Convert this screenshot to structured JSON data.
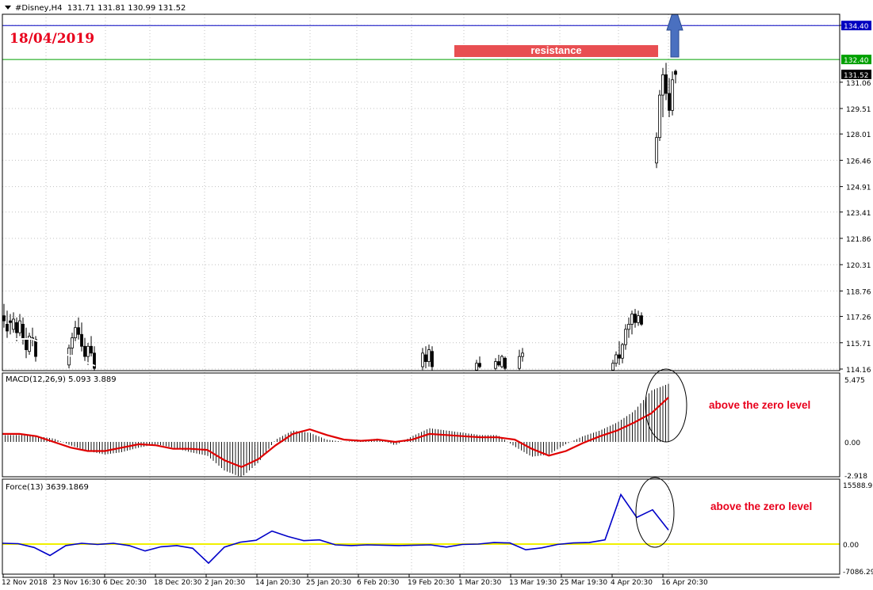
{
  "header": {
    "symbol_label": "#Disney,H4",
    "ohlc": "131.71 131.81 130.99 131.52",
    "date_annotation": "18/04/2019"
  },
  "annotations": {
    "resistance_label": "resistance",
    "macd_note": "above the zero level",
    "force_note": "above the zero level"
  },
  "colors": {
    "background": "#ffffff",
    "grid": "#c0c0c0",
    "candles": "#000000",
    "ma_line": "#ffffff",
    "resistance_line": "#00a000",
    "upper_line": "#0000c0",
    "signal_line": "#e00000",
    "force_line": "#0000c8",
    "zero_line": "#f0f000",
    "annotation_text": "#e8001c",
    "arrow": "#4a70c0"
  },
  "chart_data": [
    {
      "type": "candlestick",
      "title": "#Disney,H4",
      "ylim": [
        114.16,
        134.41
      ],
      "y_ticks": [
        "134.41",
        "131.06",
        "129.51",
        "128.01",
        "126.46",
        "124.91",
        "123.41",
        "121.86",
        "120.31",
        "118.76",
        "117.26",
        "115.71",
        "114.16"
      ],
      "price_tags": [
        {
          "value": 134.4,
          "label": "134.40",
          "color": "#0000c0"
        },
        {
          "value": 132.4,
          "label": "132.40",
          "color": "#00a000"
        },
        {
          "value": 131.52,
          "label": "131.52",
          "color": "#000000"
        }
      ],
      "x_tick_labels": [
        "12 Nov 2018",
        "23 Nov 16:30",
        "6 Dec 20:30",
        "18 Dec 20:30",
        "2 Jan 20:30",
        "14 Jan 20:30",
        "25 Jan 20:30",
        "6 Feb 20:30",
        "19 Feb 20:30",
        "1 Mar 20:30",
        "13 Mar 19:30",
        "25 Mar 19:30",
        "4 Apr 20:30",
        "16 Apr 20:30"
      ],
      "annotations": [
        "resistance",
        "arrow up",
        "18/04/2019"
      ],
      "recent_candles": [
        {
          "o": 114.2,
          "h": 115.0,
          "l": 114.1,
          "c": 114.6
        },
        {
          "o": 114.6,
          "h": 115.9,
          "l": 114.4,
          "c": 115.5
        },
        {
          "o": 115.5,
          "h": 117.0,
          "l": 115.3,
          "c": 116.6
        },
        {
          "o": 116.6,
          "h": 117.6,
          "l": 116.2,
          "c": 117.3
        },
        {
          "o": 117.3,
          "h": 117.5,
          "l": 116.5,
          "c": 116.9
        },
        {
          "o": 126.3,
          "h": 128.1,
          "l": 126.0,
          "c": 127.8
        },
        {
          "o": 127.8,
          "h": 130.6,
          "l": 127.6,
          "c": 130.3
        },
        {
          "o": 130.3,
          "h": 131.9,
          "l": 129.0,
          "c": 131.5
        },
        {
          "o": 131.5,
          "h": 132.2,
          "l": 130.0,
          "c": 130.4
        },
        {
          "o": 130.4,
          "h": 131.3,
          "l": 129.0,
          "c": 129.4
        },
        {
          "o": 129.4,
          "h": 131.7,
          "l": 129.1,
          "c": 131.2
        },
        {
          "o": 131.71,
          "h": 131.81,
          "l": 130.99,
          "c": 131.52
        }
      ]
    },
    {
      "type": "histogram+line",
      "title": "MACD(12,26,9) 5.093 3.889",
      "ylim": [
        -2.918,
        5.475
      ],
      "y_ticks": [
        "5.475",
        "0.00",
        "-2.918"
      ],
      "series": [
        {
          "values": [
            0.6,
            0.6,
            0.5,
            0.3,
            -0.3,
            -0.8,
            -1.1,
            -0.9,
            -0.5,
            -0.2,
            -0.5,
            -0.9,
            -1.2,
            -2.5,
            -3.1,
            -1.8,
            0.2,
            1.0,
            0.8,
            0.2,
            0.0,
            0.1,
            0.3,
            -0.3,
            0.5,
            1.2,
            1.0,
            0.8,
            0.6,
            0.6,
            -0.4,
            -1.3,
            -1.1,
            -0.2,
            0.5,
            1.0,
            1.7,
            2.7,
            4.5,
            5.09
          ]
        },
        {
          "values": [
            0.7,
            0.7,
            0.5,
            0.0,
            -0.5,
            -0.8,
            -0.8,
            -0.5,
            -0.2,
            -0.3,
            -0.6,
            -0.6,
            -0.7,
            -1.6,
            -2.2,
            -1.5,
            -0.3,
            0.7,
            1.1,
            0.6,
            0.2,
            0.1,
            0.2,
            0.0,
            0.2,
            0.7,
            0.6,
            0.5,
            0.4,
            0.4,
            0.2,
            -0.6,
            -1.2,
            -0.8,
            -0.1,
            0.5,
            1.0,
            1.7,
            2.5,
            3.89
          ]
        }
      ]
    },
    {
      "type": "line",
      "title": "Force(13) 3639.1869",
      "ylim": [
        -7086.29,
        15588.95
      ],
      "y_ticks": [
        "15588.95",
        "0.00",
        "-7086.29"
      ],
      "series": [
        {
          "values": [
            200,
            100,
            -900,
            -3000,
            -400,
            200,
            -100,
            200,
            -400,
            -1800,
            -700,
            -400,
            -1100,
            -5000,
            -800,
            500,
            1000,
            3400,
            2000,
            900,
            1100,
            -200,
            -400,
            -200,
            -300,
            -400,
            -300,
            -200,
            -800,
            -100,
            0,
            400,
            300,
            -1500,
            -1000,
            -100,
            300,
            400,
            1100,
            13000,
            7000,
            9000,
            3700
          ]
        }
      ]
    }
  ]
}
